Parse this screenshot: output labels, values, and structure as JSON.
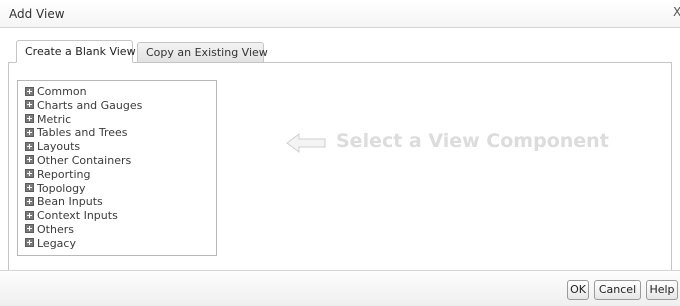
{
  "dialog": {
    "title": "Add View",
    "close_glyph": "X"
  },
  "tabs": [
    {
      "label": "Create a Blank View",
      "active": true
    },
    {
      "label": "Copy an Existing View",
      "active": false
    }
  ],
  "tree": {
    "items": [
      {
        "label": "Common"
      },
      {
        "label": "Charts and Gauges"
      },
      {
        "label": "Metric"
      },
      {
        "label": "Tables and Trees"
      },
      {
        "label": "Layouts"
      },
      {
        "label": "Other Containers"
      },
      {
        "label": "Reporting"
      },
      {
        "label": "Topology"
      },
      {
        "label": "Bean Inputs"
      },
      {
        "label": "Context Inputs"
      },
      {
        "label": "Others"
      },
      {
        "label": "Legacy"
      }
    ]
  },
  "hint": {
    "icon": "left-arrow-icon",
    "text": "Select a View Component"
  },
  "footer": {
    "ok_label": "OK",
    "cancel_label": "Cancel",
    "help_label": "Help"
  }
}
